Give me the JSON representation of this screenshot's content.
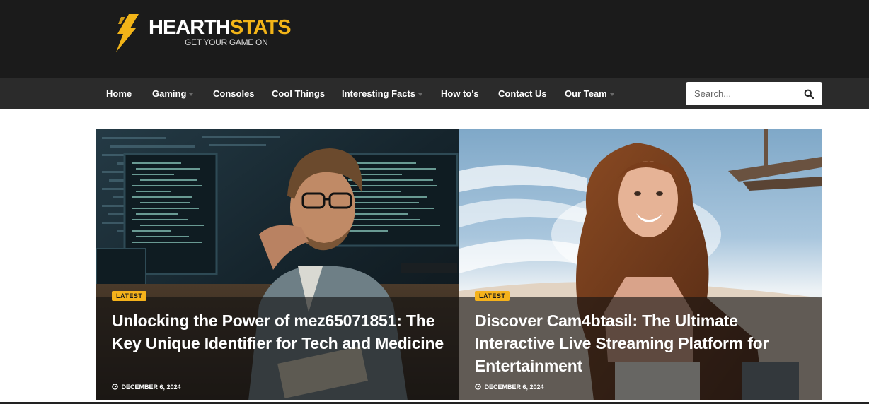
{
  "header": {
    "logo_primary": "HEARTH",
    "logo_accent": "STATS",
    "tagline": "GET YOUR GAME ON",
    "logo_icon": "lightning-bolt-icon",
    "background": "#1b1b1b",
    "accent_color": "#f2b418"
  },
  "nav": {
    "items": [
      {
        "label": "Home",
        "has_dropdown": false
      },
      {
        "label": "Gaming",
        "has_dropdown": true
      },
      {
        "label": "Consoles",
        "has_dropdown": false
      },
      {
        "label": "Cool Things",
        "has_dropdown": false
      },
      {
        "label": "Interesting Facts",
        "has_dropdown": true
      },
      {
        "label": "How to's",
        "has_dropdown": false
      },
      {
        "label": "Contact Us",
        "has_dropdown": false
      },
      {
        "label": "Our Team",
        "has_dropdown": true
      }
    ],
    "search": {
      "placeholder": "Search...",
      "value": "",
      "icon": "search-icon"
    }
  },
  "featured": [
    {
      "badge": "LATEST",
      "title": "Unlocking the Power of mez65071851: The Key Unique Identifier for Tech and Medicine",
      "date": "DECEMBER 6, 2024",
      "image": "man with glasses at computer screens showing code"
    },
    {
      "badge": "LATEST",
      "title": "Discover Cam4btasil: The Ultimate Interactive Live Streaming Platform for Entertainment",
      "date": "DECEMBER 6, 2024",
      "image": "smiling woman on a sunny beach"
    }
  ],
  "colors": {
    "badge": "#f5b21b",
    "navbar": "#2b2b2b"
  }
}
